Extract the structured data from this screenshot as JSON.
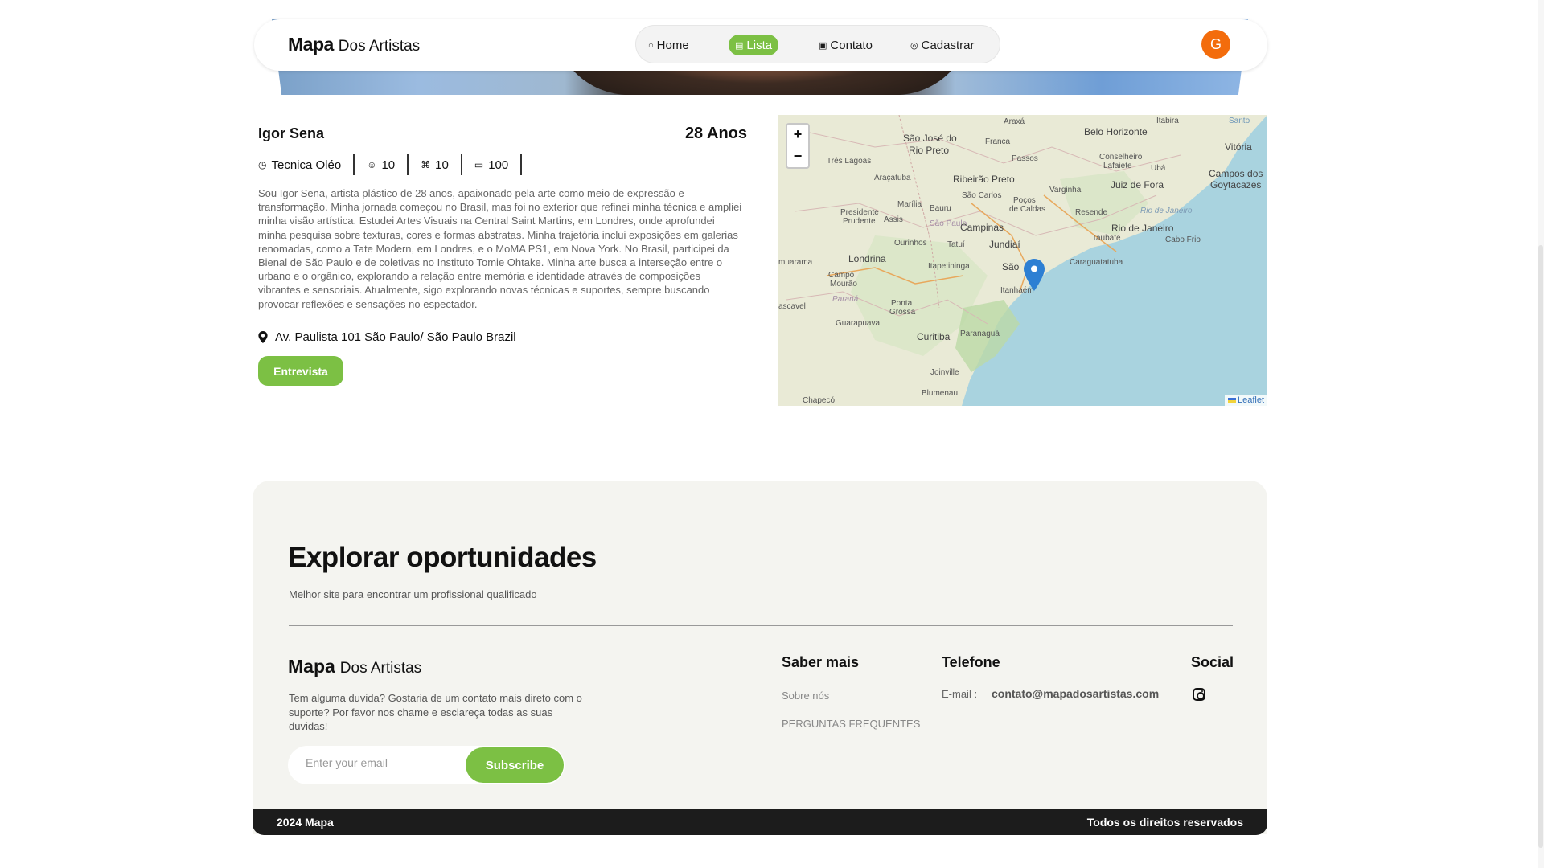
{
  "brand": {
    "strong": "Mapa",
    "light": "Dos Artistas"
  },
  "nav": {
    "items": [
      {
        "label": "Home",
        "icon": "home-icon"
      },
      {
        "label": "Lista",
        "icon": "list-icon",
        "active": true
      },
      {
        "label": "Contato",
        "icon": "contact-card-icon"
      },
      {
        "label": "Cadastrar",
        "icon": "location-pin-icon"
      }
    ],
    "avatar_initial": "G",
    "avatar_color": "#f36c0c"
  },
  "artist": {
    "name": "Igor Sena",
    "age": "28 Anos",
    "stats": [
      {
        "icon": "clock-icon",
        "value": "Tecnica Oléo"
      },
      {
        "icon": "user-circle-icon",
        "value": "10"
      },
      {
        "icon": "network-icon",
        "value": "10"
      },
      {
        "icon": "ticket-icon",
        "value": "100"
      }
    ],
    "bio": "Sou Igor Sena, artista plástico de 28 anos, apaixonado pela arte como meio de expressão e transformação. Minha jornada começou no Brasil, mas foi no exterior que refinei minha técnica e ampliei minha visão artística. Estudei Artes Visuais na Central Saint Martins, em Londres, onde aprofundei minha pesquisa sobre texturas, cores e formas abstratas. Minha trajetória inclui exposições em galerias renomadas, como a Tate Modern, em Londres, e o MoMA PS1, em Nova York. No Brasil, participei da Bienal de São Paulo e de coletivas no Instituto Tomie Ohtake. Minha arte busca a interseção entre o urbano e o orgânico, explorando a relação entre memória e identidade através de composições vibrantes e sensoriais. Atualmente, sigo explorando novas técnicas e suportes, sempre buscando provocar reflexões e sensações no espectador.",
    "address": "Av. Paulista 101 São Paulo/ São Paulo Brazil",
    "interview_button": "Entrevista"
  },
  "map": {
    "zoom_in": "+",
    "zoom_out": "−",
    "attribution": "Leaflet",
    "places": [
      "Araxá",
      "Itabira",
      "Belo Horizonte",
      "Santo",
      "Vitória",
      "São José do",
      "Rio Preto",
      "Franca",
      "Três Lagoas",
      "Araçatuba",
      "Ribeirão Preto",
      "Passos",
      "Conselheiro",
      "Lafaiete",
      "Ubá",
      "Varginha",
      "Juiz de Fora",
      "Campos dos",
      "Goytacazes",
      "Marília",
      "Bauru",
      "São Carlos",
      "Poços",
      "de Caldas",
      "Presidente",
      "Prudente",
      "Assis",
      "São Paulo",
      "Campinas",
      "Resende",
      "Rio de Janeiro",
      "Rio de Janeiro",
      "Ourinhos",
      "Jundiaí",
      "Taubaté",
      "Cabo Frio",
      "muarama",
      "Londrina",
      "Tatuí",
      "Itapetininga",
      "São",
      "Caraguatatuba",
      "Campo",
      "Mourão",
      "Itanhaém",
      "ascavel",
      "Paraná",
      "Ponta",
      "Grossa",
      "Guarapuava",
      "Curitiba",
      "Paranaguá",
      "Joinville",
      "Blumenau",
      "Chapecó"
    ],
    "water_color": "#a9d3df",
    "land_color": "#e9ead6"
  },
  "footer": {
    "title": "Explorar oportunidades",
    "subtitle": "Melhor site para encontrar um profissional qualificado",
    "description": "Tem alguma duvida? Gostaria de um contato mais direto com o suporte? Por favor nos chame e esclareça todas as suas duvidas!",
    "email_placeholder": "Enter your email",
    "subscribe": "Subscribe",
    "saber_mais": {
      "title": "Saber mais",
      "links": [
        "Sobre nós",
        "PERGUNTAS FREQUENTES"
      ]
    },
    "telefone": {
      "title": "Telefone",
      "email_label": "E-mail :",
      "email": "contato@mapadosartistas.com"
    },
    "social": {
      "title": "Social",
      "icon": "instagram-icon"
    },
    "copyright": "2024 Mapa",
    "rights": "Todos os direitos reservados"
  },
  "accent_color": "#7cc044"
}
